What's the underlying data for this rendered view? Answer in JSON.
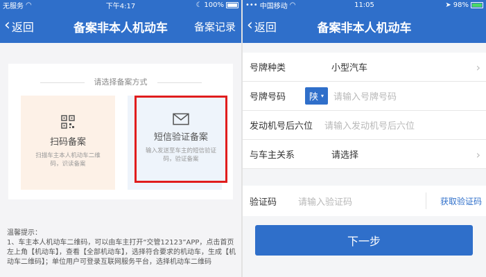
{
  "left": {
    "status": {
      "carrier": "无服务",
      "time": "下午4:17",
      "battery": "100%"
    },
    "nav": {
      "back": "返回",
      "title": "备案非本人机动车",
      "right": "备案记录"
    },
    "choose_title": "请选择备案方式",
    "options": [
      {
        "title": "扫码备案",
        "desc": "扫描车主本人机动车二维码，识读备案",
        "icon": "qrcode-icon"
      },
      {
        "title": "短信验证备案",
        "desc": "输入发送至车主的短信验证码，验证备案",
        "icon": "envelope-icon",
        "selected": true
      }
    ],
    "tips_title": "温馨提示：",
    "tips_text": "1、车主本人机动车二维码，可以由车主打开“交管12123”APP，点击首页左上角【机动车】，查看【全部机动车】，选择符合要求的机动车，生成【机动车二维码】；单位用户可登录互联网服务平台，选择机动车二维码"
  },
  "right": {
    "status": {
      "carrier": "中国移动",
      "time": "11:05",
      "battery": "98%"
    },
    "nav": {
      "back": "返回",
      "title": "备案非本人机动车"
    },
    "rows": [
      {
        "label": "号牌种类",
        "value": "小型汽车"
      },
      {
        "label": "号牌号码",
        "province": "陕",
        "placeholder": "请输入号牌号码"
      },
      {
        "label": "发动机号后六位",
        "placeholder": "请输入发动机号后六位"
      },
      {
        "label": "与车主关系",
        "value": "请选择"
      }
    ],
    "code": {
      "label": "验证码",
      "placeholder": "请输入验证码",
      "get": "获取验证码"
    },
    "next": "下一步"
  }
}
